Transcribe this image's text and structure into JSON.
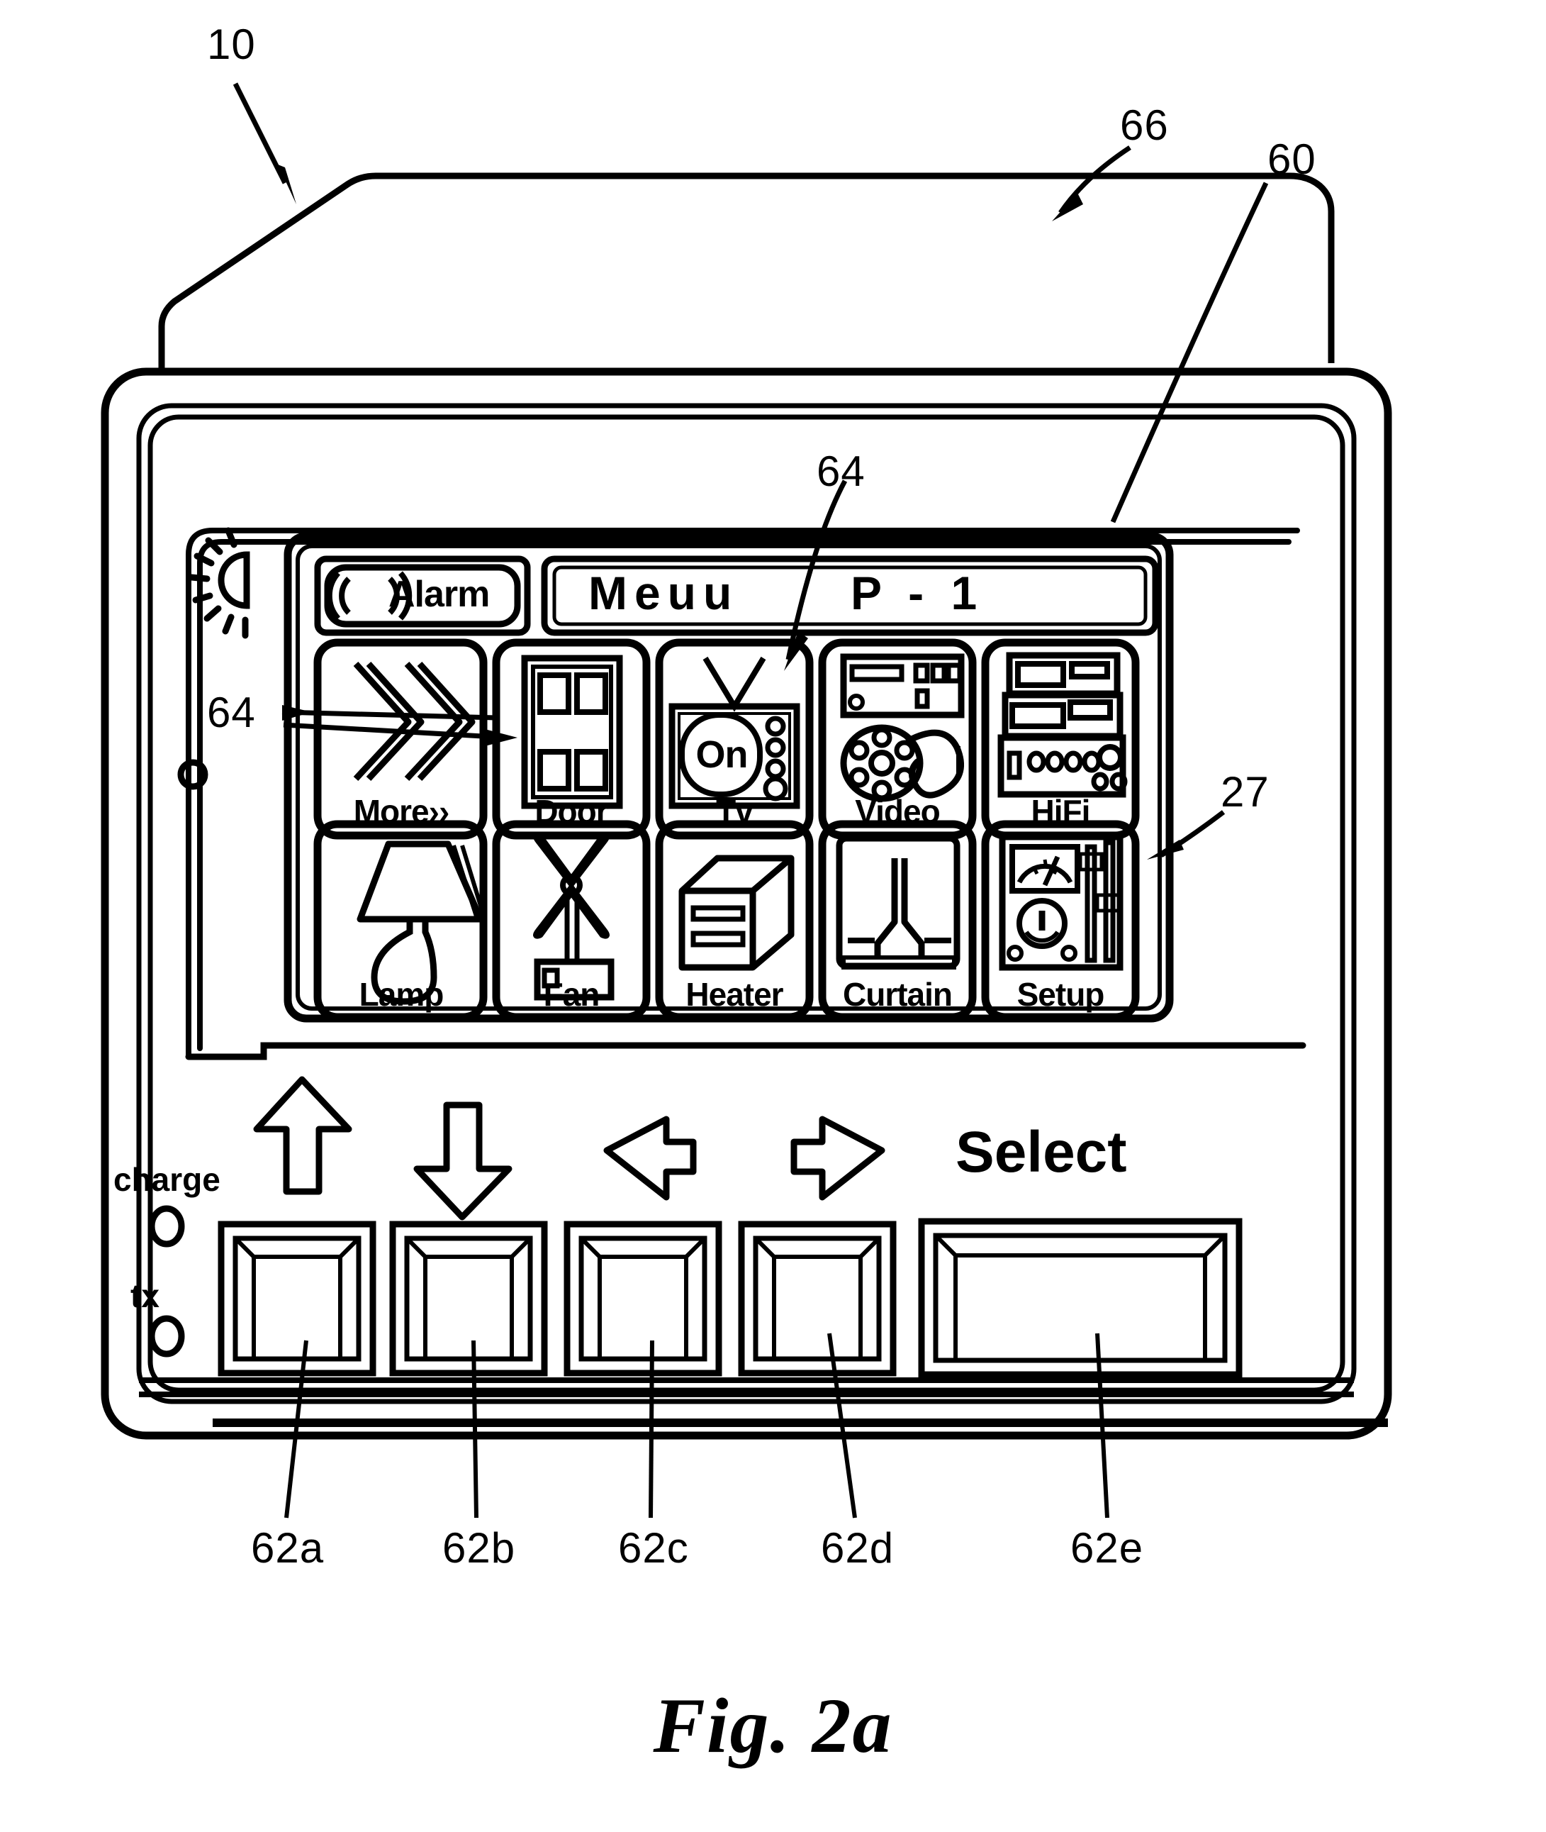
{
  "figure": {
    "caption": "Fig. 2a",
    "reference_numerals": [
      {
        "id": "10",
        "label": "10"
      },
      {
        "id": "66",
        "label": "66"
      },
      {
        "id": "60",
        "label": "60"
      },
      {
        "id": "64_top",
        "label": "64"
      },
      {
        "id": "64_left",
        "label": "64"
      },
      {
        "id": "27",
        "label": "27"
      },
      {
        "id": "62a",
        "label": "62a"
      },
      {
        "id": "62b",
        "label": "62b"
      },
      {
        "id": "62c",
        "label": "62c"
      },
      {
        "id": "62d",
        "label": "62d"
      },
      {
        "id": "62e",
        "label": "62e"
      }
    ]
  },
  "device": {
    "display": {
      "brightness_icon": "half-sun-icon",
      "status_bar": {
        "alarm_icon": "alarm-signal-icon",
        "alarm_label": "Alarm",
        "title": "Meuu",
        "page": "P - 1"
      },
      "tiles": [
        {
          "label": "More››",
          "icon": "double-chevron-icon"
        },
        {
          "label": "Door",
          "icon": "door-icon"
        },
        {
          "label": "Tv",
          "icon": "television-icon",
          "screen_text": "On"
        },
        {
          "label": "Video",
          "icon": "vcr-film-reel-icon"
        },
        {
          "label": "HiFi",
          "icon": "stereo-stack-icon"
        },
        {
          "label": "Lamp",
          "icon": "table-lamp-icon"
        },
        {
          "label": "Fan",
          "icon": "fan-icon"
        },
        {
          "label": "Heater",
          "icon": "heater-icon"
        },
        {
          "label": "Curtain",
          "icon": "curtain-icon"
        },
        {
          "label": "Setup",
          "icon": "meter-sliders-icon"
        }
      ]
    },
    "indicators": [
      {
        "label": "charge",
        "icon": "led-circle-icon"
      },
      {
        "label": "tx",
        "icon": "led-circle-icon"
      }
    ],
    "arrow_keys": [
      {
        "icon": "arrow-up-icon"
      },
      {
        "icon": "arrow-down-icon"
      },
      {
        "icon": "arrow-left-icon"
      },
      {
        "icon": "arrow-right-icon"
      }
    ],
    "select_label": "Select",
    "buttons": [
      {
        "id": "62a"
      },
      {
        "id": "62b"
      },
      {
        "id": "62c"
      },
      {
        "id": "62d"
      },
      {
        "id": "62e"
      }
    ]
  }
}
